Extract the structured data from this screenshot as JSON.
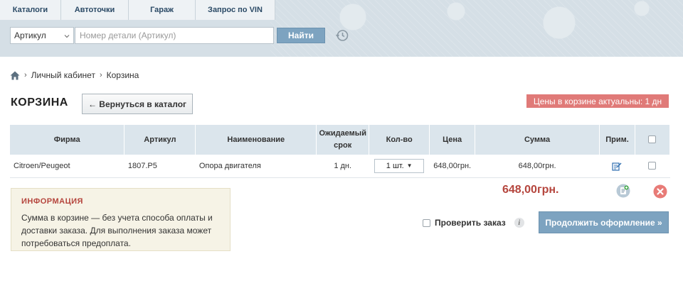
{
  "nav": {
    "tabs": [
      {
        "label": "Каталоги"
      },
      {
        "label": "Автоточки"
      },
      {
        "label": "Гараж"
      },
      {
        "label": "Запрос по VIN"
      }
    ]
  },
  "search": {
    "type_selected": "Артикул",
    "placeholder": "Номер детали (Артикул)",
    "button_label": "Найти"
  },
  "breadcrumb": {
    "items": [
      "Личный кабинет",
      "Корзина"
    ]
  },
  "page": {
    "title": "КОРЗИНА",
    "back_button": "← Вернуться в каталог",
    "price_badge": "Цены в корзине актуальны: 1 дн"
  },
  "table": {
    "headers": {
      "firm": "Фирма",
      "article": "Артикул",
      "name": "Наименование",
      "term_line1": "Ожидаемый",
      "term_line2": "срок",
      "qty": "Кол-во",
      "price": "Цена",
      "sum": "Сумма",
      "note": "Прим."
    },
    "rows": [
      {
        "firm": "Citroen/Peugeot",
        "article": "1807.P5",
        "name": "Опора двигателя",
        "term": "1 дн.",
        "qty": "1 шт.",
        "price": "648,00грн.",
        "sum": "648,00грн."
      }
    ]
  },
  "summary": {
    "total": "648,00грн."
  },
  "info": {
    "title": "ИНФОРМАЦИЯ",
    "text": "Сумма в корзине — без учета способа оплаты и доставки заказа. Для выполнения заказа может потребоваться предоплата."
  },
  "actions": {
    "check_order": "Проверить заказ",
    "info_glyph": "i",
    "continue_button": "Продолжить оформление »"
  },
  "colors": {
    "accent_blue": "#7da3c0",
    "header_bg": "#d5dfe6",
    "badge_red": "#e07a78",
    "total_red": "#b5453d"
  },
  "icons": {
    "home": "home-icon",
    "history": "history-icon",
    "edit_note": "edit-note-icon",
    "add_note": "add-note-icon",
    "remove": "remove-icon",
    "info": "info-icon",
    "dropdown": "chevron-down-icon"
  }
}
